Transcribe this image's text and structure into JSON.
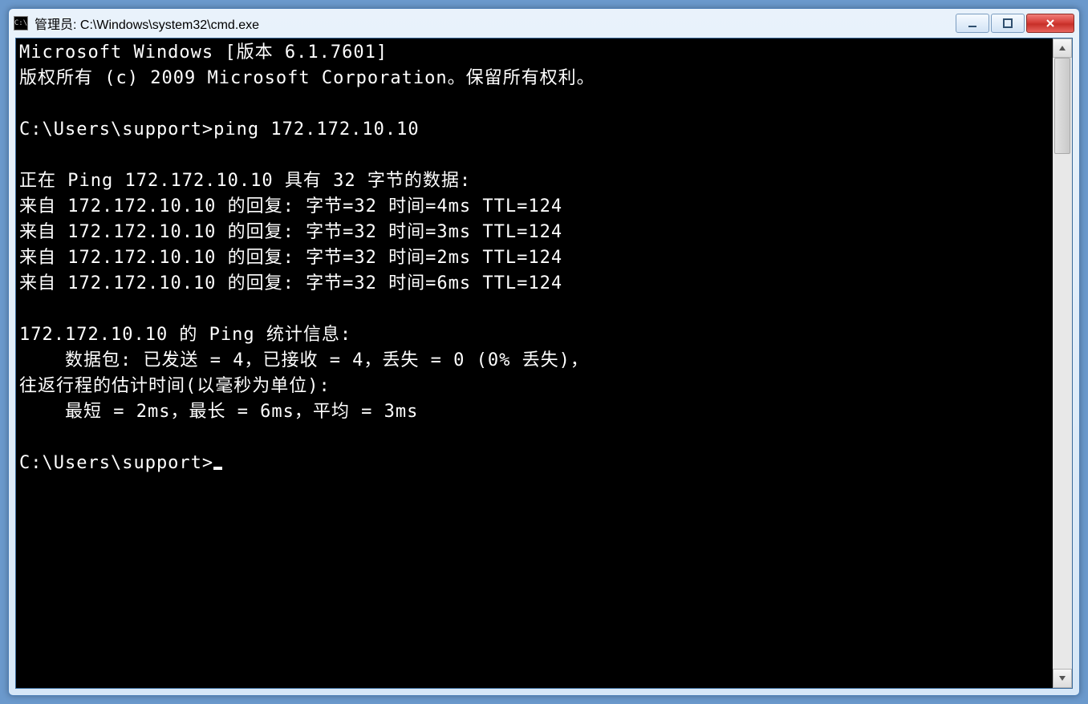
{
  "window": {
    "title": "管理员: C:\\Windows\\system32\\cmd.exe",
    "icon_label": "C:\\"
  },
  "terminal": {
    "lines": [
      "Microsoft Windows [版本 6.1.7601]",
      "版权所有 (c) 2009 Microsoft Corporation。保留所有权利。",
      "",
      "C:\\Users\\support>ping 172.172.10.10",
      "",
      "正在 Ping 172.172.10.10 具有 32 字节的数据:",
      "来自 172.172.10.10 的回复: 字节=32 时间=4ms TTL=124",
      "来自 172.172.10.10 的回复: 字节=32 时间=3ms TTL=124",
      "来自 172.172.10.10 的回复: 字节=32 时间=2ms TTL=124",
      "来自 172.172.10.10 的回复: 字节=32 时间=6ms TTL=124",
      "",
      "172.172.10.10 的 Ping 统计信息:",
      "    数据包: 已发送 = 4，已接收 = 4，丢失 = 0 (0% 丢失)，",
      "往返行程的估计时间(以毫秒为单位):",
      "    最短 = 2ms，最长 = 6ms，平均 = 3ms",
      "",
      "C:\\Users\\support>"
    ]
  }
}
